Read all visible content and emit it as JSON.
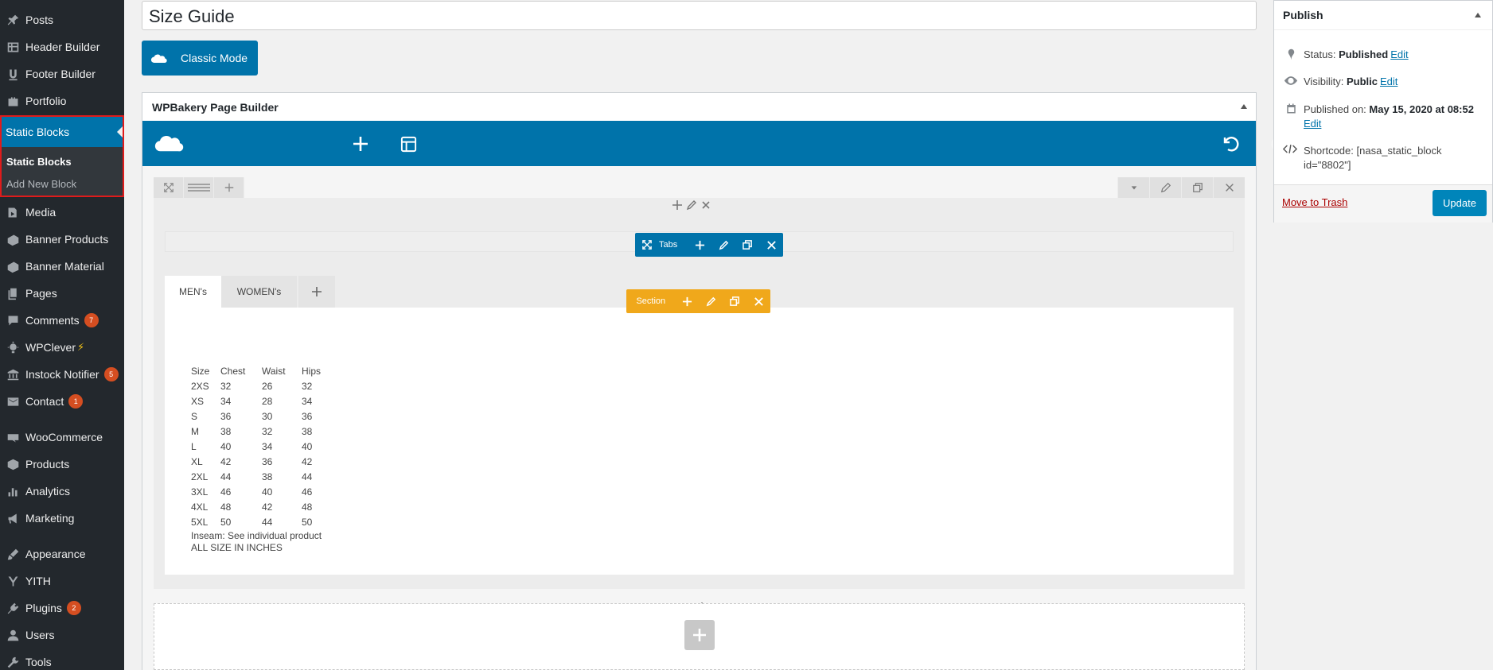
{
  "sidebar": {
    "items": [
      {
        "label": "Posts",
        "icon": "pin-icon"
      },
      {
        "label": "Header Builder",
        "icon": "grid-icon"
      },
      {
        "label": "Footer Builder",
        "icon": "footer-u-icon"
      },
      {
        "label": "Portfolio",
        "icon": "portfolio-icon"
      },
      {
        "label": "Media",
        "icon": "media-icon"
      },
      {
        "label": "Banner Products",
        "icon": "banner-icon"
      },
      {
        "label": "Banner Material",
        "icon": "banner-icon"
      },
      {
        "label": "Pages",
        "icon": "pages-icon"
      },
      {
        "label": "Comments",
        "icon": "comment-icon",
        "badge": "7"
      },
      {
        "label": "WPClever",
        "icon": "bulb-icon"
      },
      {
        "label": "Instock Notifier",
        "icon": "bank-icon",
        "badge": "5"
      },
      {
        "label": "Contact",
        "icon": "mail-icon",
        "badge": "1"
      },
      {
        "label": "WooCommerce",
        "icon": "woo-icon"
      },
      {
        "label": "Products",
        "icon": "box-icon"
      },
      {
        "label": "Analytics",
        "icon": "bars-icon"
      },
      {
        "label": "Marketing",
        "icon": "megaphone-icon"
      },
      {
        "label": "Appearance",
        "icon": "brush-icon"
      },
      {
        "label": "YITH",
        "icon": "yith-icon"
      },
      {
        "label": "Plugins",
        "icon": "plug-icon",
        "badge": "2"
      },
      {
        "label": "Users",
        "icon": "user-icon"
      },
      {
        "label": "Tools",
        "icon": "wrench-icon"
      }
    ],
    "active": {
      "label": "Static Blocks",
      "submenu": [
        "Static Blocks",
        "Add New Block"
      ]
    }
  },
  "editor": {
    "title": "Size Guide",
    "classic_mode_label": "Classic Mode"
  },
  "wpbakery": {
    "title": "WPBakery Page Builder",
    "tabs_label": "Tabs",
    "section_label": "Section",
    "tabs": [
      "MEN's",
      "WOMEN's"
    ]
  },
  "size_table": {
    "headers": [
      "Size",
      "Chest",
      "Waist",
      "Hips"
    ],
    "rows": [
      [
        "2XS",
        "32",
        "26",
        "32"
      ],
      [
        "XS",
        "34",
        "28",
        "34"
      ],
      [
        "S",
        "36",
        "30",
        "36"
      ],
      [
        "M",
        "38",
        "32",
        "38"
      ],
      [
        "L",
        "40",
        "34",
        "40"
      ],
      [
        "XL",
        "42",
        "36",
        "42"
      ],
      [
        "2XL",
        "44",
        "38",
        "44"
      ],
      [
        "3XL",
        "46",
        "40",
        "46"
      ],
      [
        "4XL",
        "48",
        "42",
        "48"
      ],
      [
        "5XL",
        "50",
        "44",
        "50"
      ]
    ],
    "note1": "Inseam: See individual product",
    "note2": "ALL SIZE IN INCHES"
  },
  "publish": {
    "title": "Publish",
    "status_label": "Status:",
    "status_value": "Published",
    "visibility_label": "Visibility:",
    "visibility_value": "Public",
    "published_label": "Published on:",
    "published_value": "May 15, 2020 at 08:52",
    "shortcode_label": "Shortcode:",
    "shortcode_value": "[nasa_static_block id=\"8802\"]",
    "edit_label": "Edit",
    "trash_label": "Move to Trash",
    "update_label": "Update"
  }
}
